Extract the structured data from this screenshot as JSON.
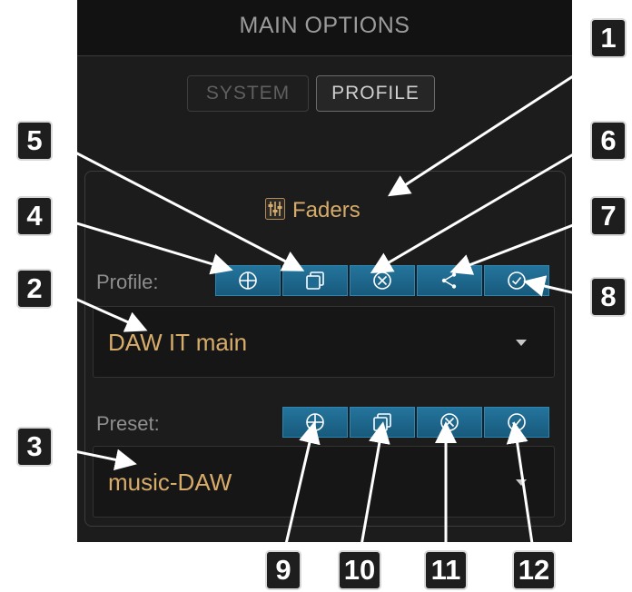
{
  "header": {
    "title": "MAIN OPTIONS"
  },
  "tabs": [
    {
      "label": "SYSTEM"
    },
    {
      "label": "PROFILE"
    }
  ],
  "section": {
    "title": "Faders",
    "icon": "sliders-icon",
    "profile": {
      "label": "Profile:",
      "buttons": [
        "add-icon",
        "copy-icon",
        "delete-icon",
        "share-icon",
        "apply-icon"
      ],
      "selected": "DAW IT main"
    },
    "preset": {
      "label": "Preset:",
      "buttons": [
        "add-icon",
        "copy-icon",
        "delete-icon",
        "apply-icon"
      ],
      "selected": "music-DAW"
    }
  },
  "callouts": [
    "1",
    "2",
    "3",
    "4",
    "5",
    "6",
    "7",
    "8",
    "9",
    "10",
    "11",
    "12"
  ],
  "colors": {
    "accent": "#d7ac6a",
    "button": "#1f6a90",
    "panel": "#1c1c1c"
  }
}
